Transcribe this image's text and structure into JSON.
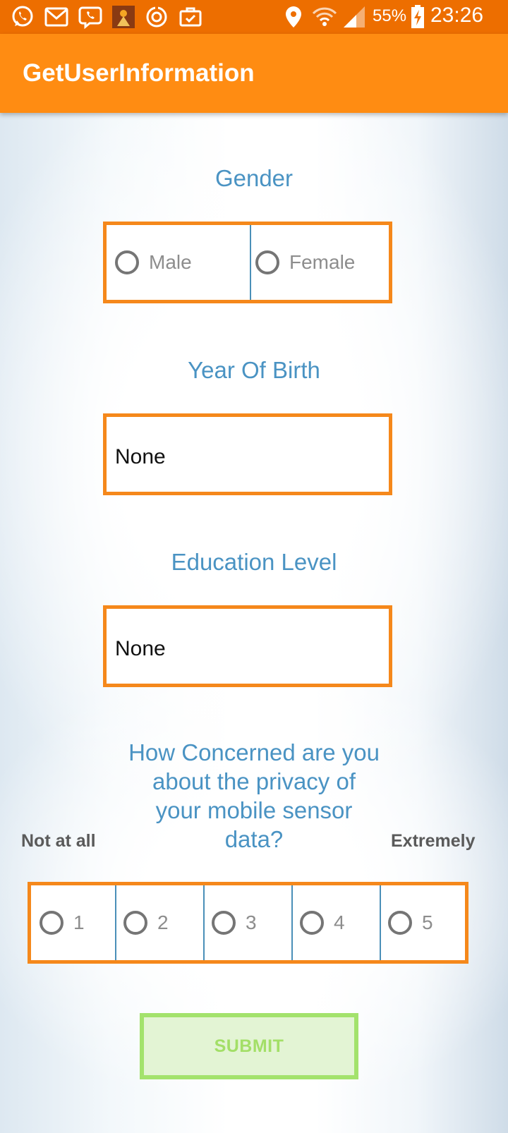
{
  "status_bar": {
    "icons": [
      "whatsapp-icon",
      "gmail-icon",
      "viber-icon",
      "game-app-icon",
      "sync-icon",
      "briefcase-check-icon",
      "location-icon",
      "wifi-icon",
      "signal-icon",
      "battery-charging-icon"
    ],
    "battery": "55%",
    "time": "23:26"
  },
  "app_bar": {
    "title": "GetUserInformation"
  },
  "gender": {
    "label": "Gender",
    "options": [
      "Male",
      "Female"
    ]
  },
  "year_of_birth": {
    "label": "Year Of Birth",
    "value": "None"
  },
  "education_level": {
    "label": "Education Level",
    "value": "None"
  },
  "privacy_concern": {
    "question_lines": [
      "How Concerned are you",
      "about the privacy of",
      "your mobile sensor",
      "data?"
    ],
    "low_label": "Not at all",
    "high_label": "Extremely",
    "options": [
      "1",
      "2",
      "3",
      "4",
      "5"
    ]
  },
  "submit_label": "SUBMIT",
  "colors": {
    "status_bar": "#ed6e00",
    "app_bar": "#ff8c12",
    "label_blue": "#4a93c3",
    "box_border_orange": "#f5881b",
    "submit_border_green": "#a3e26c",
    "submit_fill": "#e3f4d4"
  }
}
